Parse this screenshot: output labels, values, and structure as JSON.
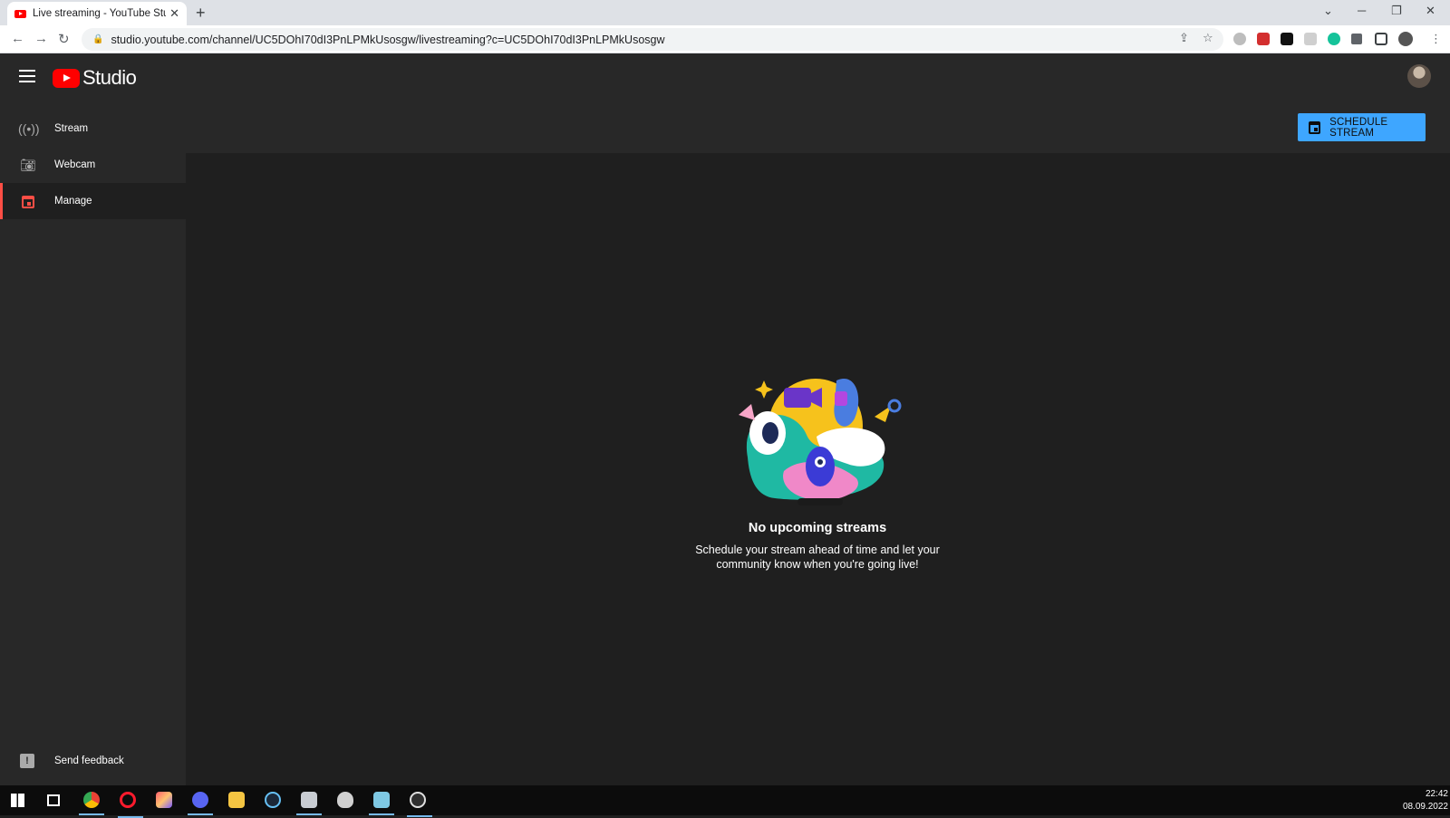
{
  "browser": {
    "tab_title": "Live streaming - YouTube Studio",
    "tab_close": "✕",
    "new_tab": "+",
    "url": "studio.youtube.com/channel/UC5DOhI70dI3PnLPMkUsosgw/livestreaming?c=UC5DOhI70dI3PnLPMkUsosgw"
  },
  "app": {
    "logo_text": "Studio"
  },
  "sidebar": {
    "items": [
      {
        "label": "Stream",
        "icon": "stream-broadcast-icon"
      },
      {
        "label": "Webcam",
        "icon": "camera-icon"
      },
      {
        "label": "Manage",
        "icon": "calendar-icon",
        "active": true
      }
    ],
    "feedback_label": "Send feedback"
  },
  "toolbar": {
    "schedule_label": "SCHEDULE STREAM"
  },
  "empty_state": {
    "title": "No upcoming streams",
    "description": "Schedule your stream ahead of time and let your community know when you're going live!"
  },
  "taskbar": {
    "time": "22:42",
    "date": "08.09.2022"
  },
  "colors": {
    "accent_blue": "#3ea6ff",
    "active_red": "#ff4e45",
    "youtube_red": "#ff0000"
  }
}
